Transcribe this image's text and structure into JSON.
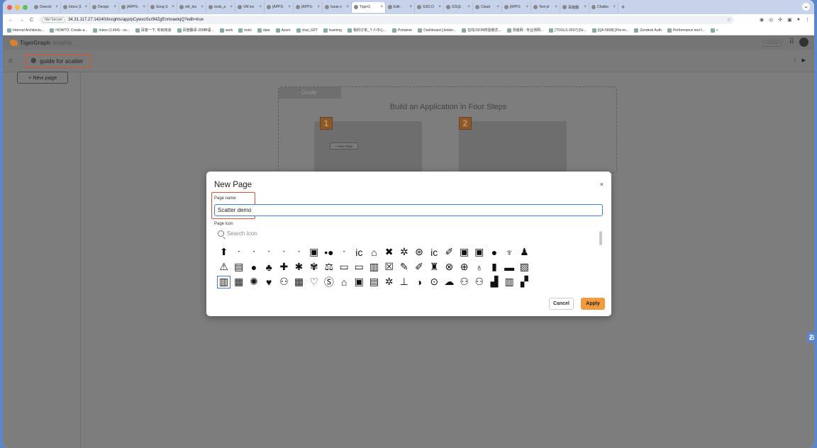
{
  "browser": {
    "tabs": [
      {
        "label": "Downlo"
      },
      {
        "label": "Inbox (1"
      },
      {
        "label": "Design"
      },
      {
        "label": "[APPS-"
      },
      {
        "label": "Song S"
      },
      {
        "label": "mlt_tes"
      },
      {
        "label": "tools_a"
      },
      {
        "label": "VM ins"
      },
      {
        "label": "[APPS-"
      },
      {
        "label": "[APPS-"
      },
      {
        "label": "Issue n"
      },
      {
        "label": "TigerG"
      },
      {
        "label": "Edit -"
      },
      {
        "label": "SSO.O"
      },
      {
        "label": "GSQL"
      },
      {
        "label": "Cloud"
      },
      {
        "label": "[APPS"
      },
      {
        "label": "Test pl"
      },
      {
        "label": "百度翻"
      },
      {
        "label": "Chatbo"
      }
    ],
    "security_badge": "Not Secure",
    "url": "34.31.117.27:14240/insights/app/pCywxoScr94ZgEnmrawtqQ?edit=true",
    "bookmarks": [
      "Internal Architectu...",
      "HOWTO: Create a...",
      "Inbox (1,494) - so...",
      "百度一下, 你就知道",
      "百度翻译-200种语...",
      "work",
      "tools",
      "data",
      "Azure",
      "chat_GPT",
      "learning",
      "我的订单_个人中心...",
      "Portainer",
      "Dashboard [Jenkin...",
      "在线JSON校验格式...",
      "测速网 - 专业测网...",
      "[TOOLS-2697] [Gr...",
      "[QA-5808] [Pre-m...",
      "Zendesk Auth",
      "Performance test f...",
      "»"
    ]
  },
  "app": {
    "logo_text": "TigerGraph",
    "logo_suffix": "Insights",
    "version": "v3.10.0",
    "app_name": "guide for scatter",
    "new_page_label": "+ New page",
    "guide": {
      "tab_label": "Guide",
      "title": "Build an Application in Four Steps",
      "step1_num": "1",
      "step2_num": "2",
      "step1_button": "+ New Page"
    }
  },
  "modal": {
    "title": "New Page",
    "close_label": "×",
    "page_name_label": "Page name",
    "page_name_value": "Scatter demo",
    "page_icon_label": "Page icon",
    "search_placeholder": "Search Icon",
    "cancel_label": "Cancel",
    "apply_label": "Apply",
    "icon_rows": [
      [
        "⬆",
        "•",
        "•",
        "•",
        "•",
        "•",
        "▣",
        "•●",
        "•",
        "ic",
        "⌂",
        "✖",
        "✲",
        "⊛",
        "ic",
        "✐",
        "▣",
        "▣",
        "●",
        "♆",
        "♟"
      ],
      [
        "⚠",
        "▤",
        "●",
        "♣",
        "✚",
        "✱",
        "✾",
        "⚖",
        "▭",
        "▭",
        "▥",
        "☒",
        "✎",
        "✐",
        "♜",
        "⊗",
        "⊕",
        "♁",
        "▮",
        "▬",
        "▨"
      ],
      [
        "▥",
        "▦",
        "✺",
        "♥",
        "⚇",
        "▦",
        "♡",
        "Ⓢ",
        "⌂",
        "▣",
        "▤",
        "✲",
        "⊥",
        "◑",
        "⊙",
        "☁",
        "⚇",
        "⚇",
        "▟",
        "▥",
        "▞"
      ]
    ]
  },
  "float_button_label": "お"
}
